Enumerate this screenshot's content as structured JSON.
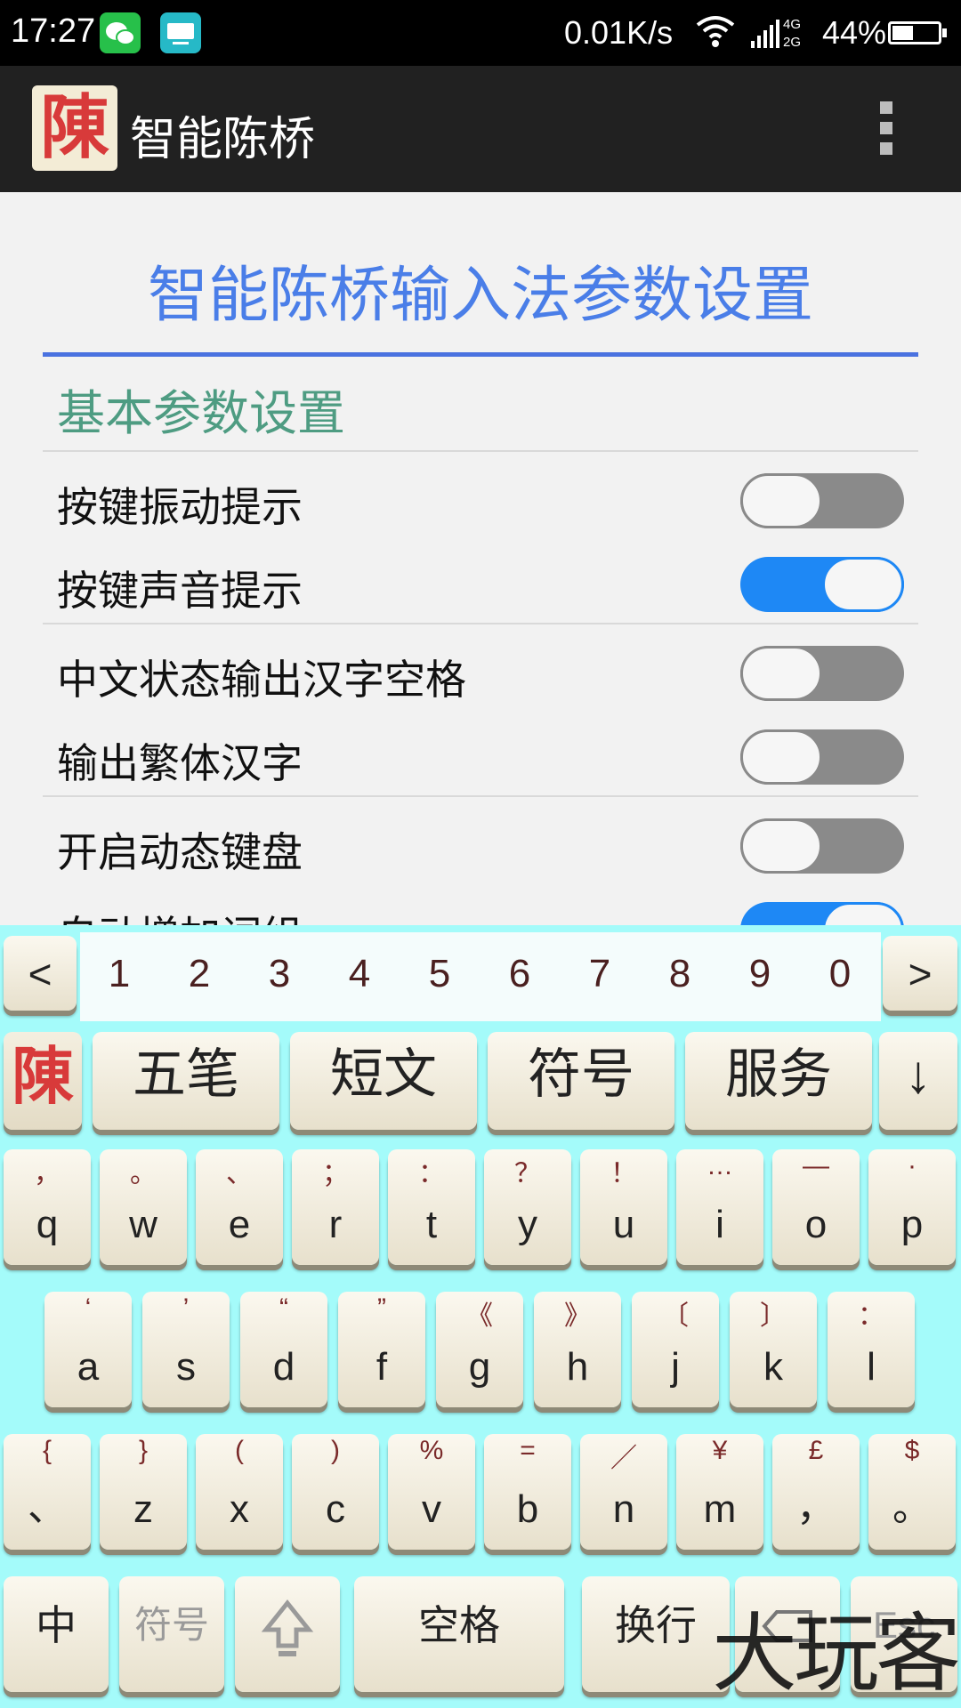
{
  "status_bar": {
    "time": "17:27",
    "net_speed": "0.01K/s",
    "network_4g": "4G",
    "network_2g": "2G",
    "battery_percent": "44%",
    "battery_level": 0.44,
    "icons": [
      "wechat-icon",
      "keyboard-notification-icon",
      "wifi-icon",
      "cell-signal-icon",
      "battery-icon"
    ]
  },
  "action_bar": {
    "logo_char": "陳",
    "title": "智能陈桥",
    "overflow_icon": "overflow-menu-icon"
  },
  "settings": {
    "page_title": "智能陈桥输入法参数设置",
    "section_title": "基本参数设置",
    "items": [
      {
        "label": "按键振动提示",
        "checked": false
      },
      {
        "label": "按键声音提示",
        "checked": true
      },
      {
        "label": "中文状态输出汉字空格",
        "checked": false
      },
      {
        "label": "输出繁体汉字",
        "checked": false
      },
      {
        "label": "开启动态键盘",
        "checked": false
      },
      {
        "label": "自动增加词组",
        "checked": true
      }
    ]
  },
  "keyboard": {
    "prev_label": "<",
    "next_label": ">",
    "numbers": [
      "1",
      "2",
      "3",
      "4",
      "5",
      "6",
      "7",
      "8",
      "9",
      "0"
    ],
    "function_row": {
      "logo_char": "陳",
      "keys": [
        "五笔",
        "短文",
        "符号",
        "服务"
      ],
      "hide_label": "↓"
    },
    "row1": [
      {
        "sec": "，",
        "pri": "q"
      },
      {
        "sec": "。",
        "pri": "w"
      },
      {
        "sec": "、",
        "pri": "e"
      },
      {
        "sec": "；",
        "pri": "r"
      },
      {
        "sec": "：",
        "pri": "t"
      },
      {
        "sec": "？",
        "pri": "y"
      },
      {
        "sec": "！",
        "pri": "u"
      },
      {
        "sec": "…",
        "pri": "i"
      },
      {
        "sec": "—",
        "pri": "o"
      },
      {
        "sec": "·",
        "pri": "p"
      }
    ],
    "row2": [
      {
        "sec": "‘",
        "pri": "a"
      },
      {
        "sec": "’",
        "pri": "s"
      },
      {
        "sec": "“",
        "pri": "d"
      },
      {
        "sec": "”",
        "pri": "f"
      },
      {
        "sec": "《",
        "pri": "g"
      },
      {
        "sec": "》",
        "pri": "h"
      },
      {
        "sec": "〔",
        "pri": "j"
      },
      {
        "sec": "〕",
        "pri": "k"
      },
      {
        "sec": "：",
        "pri": "l"
      }
    ],
    "row3": [
      {
        "sec": "{",
        "pri": "、"
      },
      {
        "sec": "}",
        "pri": "z"
      },
      {
        "sec": "(",
        "pri": "x"
      },
      {
        "sec": ")",
        "pri": "c"
      },
      {
        "sec": "%",
        "pri": "v"
      },
      {
        "sec": "=",
        "pri": "b"
      },
      {
        "sec": "／",
        "pri": "n"
      },
      {
        "sec": "¥",
        "pri": "m"
      },
      {
        "sec": "£",
        "pri": "，"
      },
      {
        "sec": "$",
        "pri": "。"
      }
    ],
    "bottom_row": {
      "zhong": "中",
      "symbol": "符号",
      "space": "空格",
      "enter": "换行",
      "esc": "Esc"
    },
    "watermark": "大玩客"
  },
  "colors": {
    "accent_blue": "#4a7ee8",
    "section_green": "#4e9c82",
    "switch_on": "#1e88f5",
    "switch_off": "#8a8a8a",
    "keyboard_bg": "#a4fbfa"
  }
}
